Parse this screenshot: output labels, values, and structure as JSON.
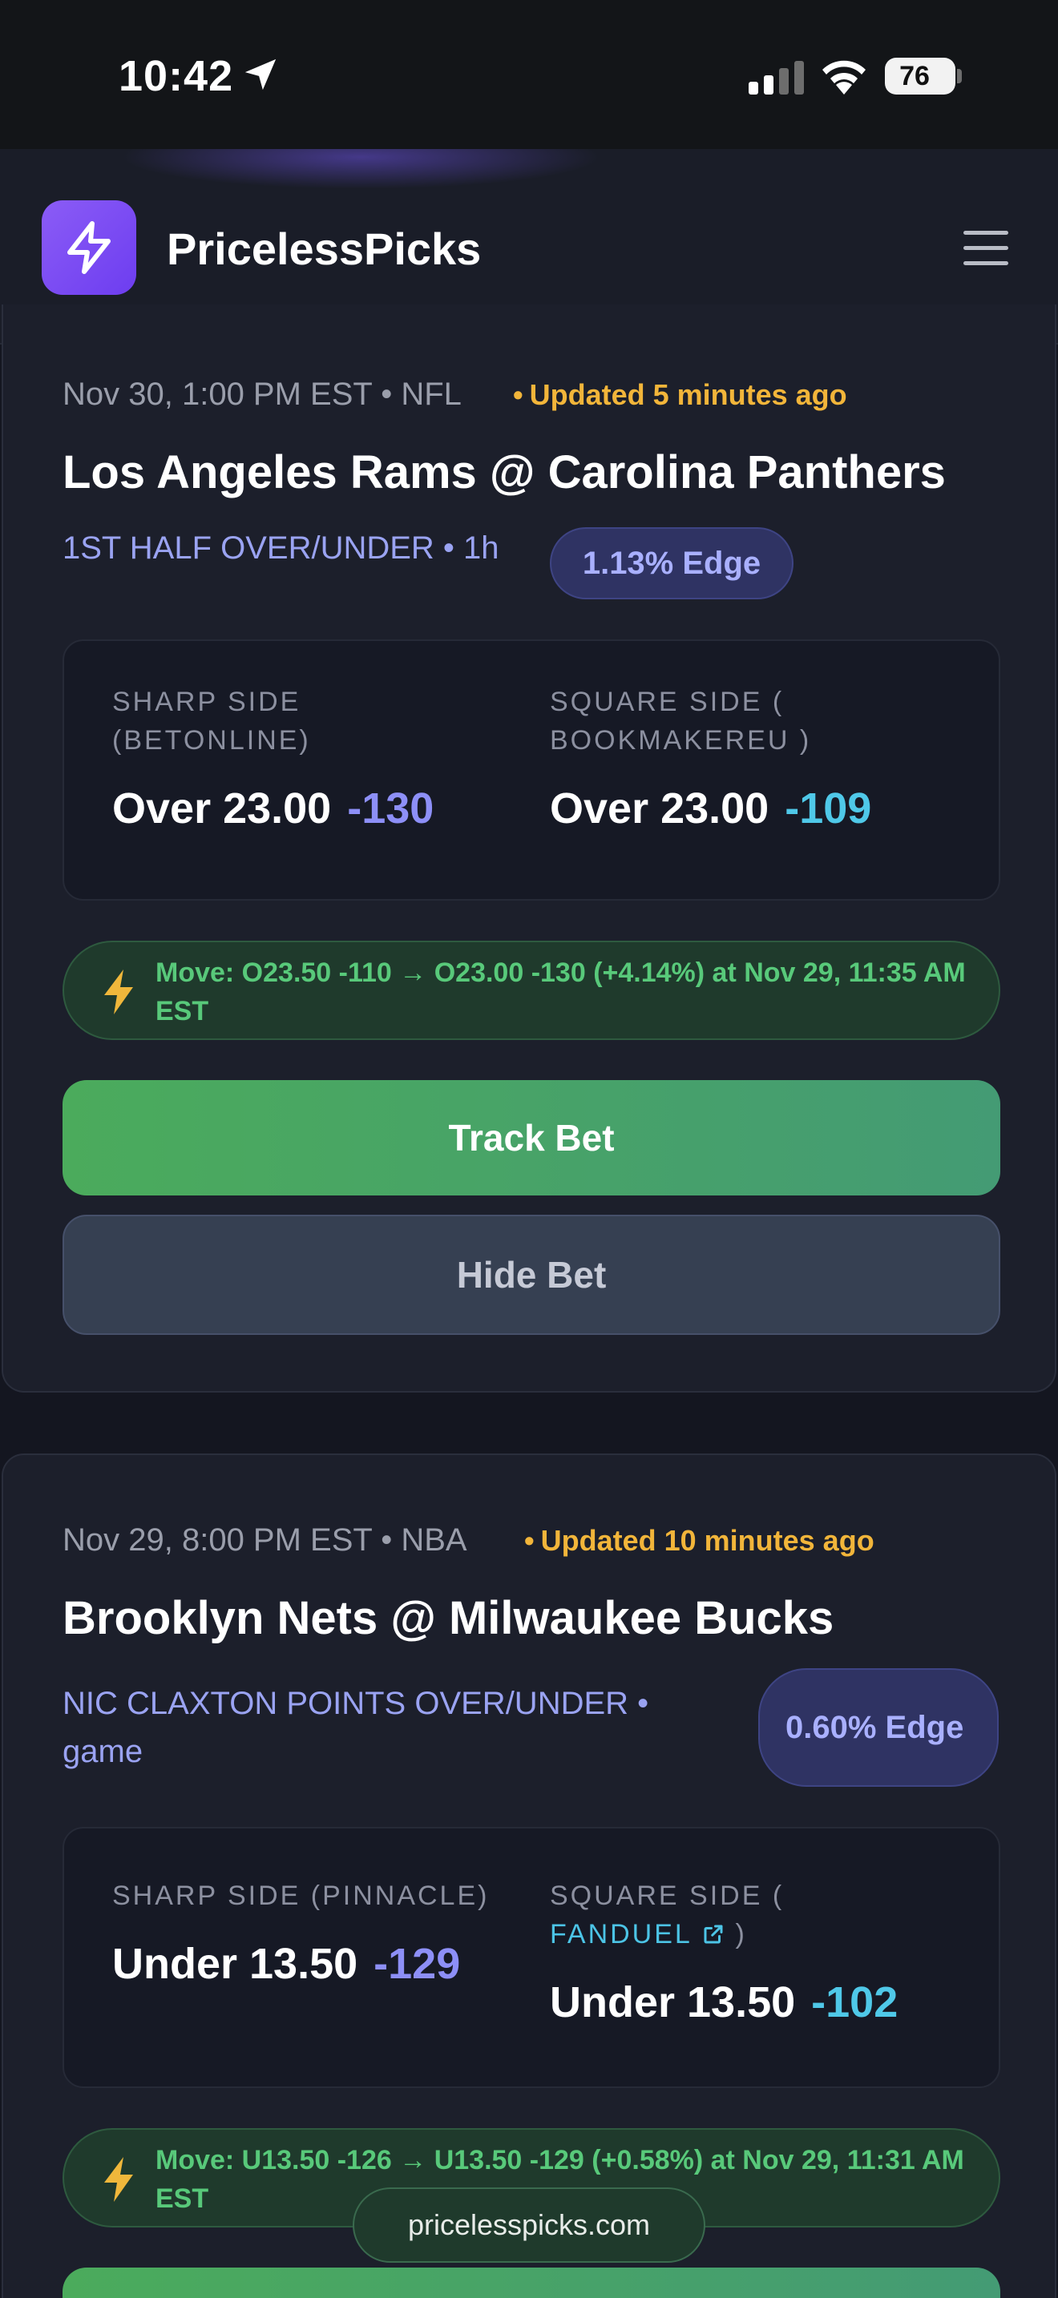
{
  "status_bar": {
    "time": "10:42",
    "battery": "76",
    "battery_level_percent": 76
  },
  "header": {
    "brand": "PricelessPicks",
    "accent_color": "#8b5cf6"
  },
  "picks": [
    {
      "meta": "Nov 30, 1:00 PM EST • NFL",
      "updated": "Updated 5 minutes ago",
      "matchup": "Los Angeles Rams @ Carolina Panthers",
      "market": "1ST HALF OVER/UNDER • 1h",
      "edge": "1.13% Edge",
      "sharp_label": "SHARP SIDE (BETONLINE)",
      "sharp_label_line1": "SHARP SIDE",
      "sharp_label_line2": "(BETONLINE)",
      "sharp_line": "Over 23.00",
      "sharp_price": "-130",
      "square_label_line1": "SQUARE SIDE (",
      "square_label_line2": "BOOKMAKEREU )",
      "square_line": "Over 23.00",
      "square_price": "-109",
      "move": "Move: O23.50 -110 → O23.00 -130 (+4.14%) at Nov 29, 11:35 AM EST",
      "track_label": "Track Bet",
      "hide_label": "Hide Bet"
    },
    {
      "meta": "Nov 29, 8:00 PM EST • NBA",
      "updated": "Updated 10 minutes ago",
      "matchup": "Brooklyn Nets @ Milwaukee Bucks",
      "market": "NIC CLAXTON POINTS OVER/UNDER • game",
      "edge": "0.60% Edge",
      "sharp_label": "SHARP SIDE (PINNACLE)",
      "sharp_line": "Under 13.50",
      "sharp_price": "-129",
      "square_label_line1": "SQUARE SIDE (",
      "square_book": "FANDUEL",
      "square_label_close": ")",
      "square_line": "Under 13.50",
      "square_price": "-102",
      "move": "Move: U13.50 -126 → U13.50 -129 (+0.58%) at Nov 29, 11:31 AM EST"
    }
  ],
  "url": "pricelesspicks.com"
}
